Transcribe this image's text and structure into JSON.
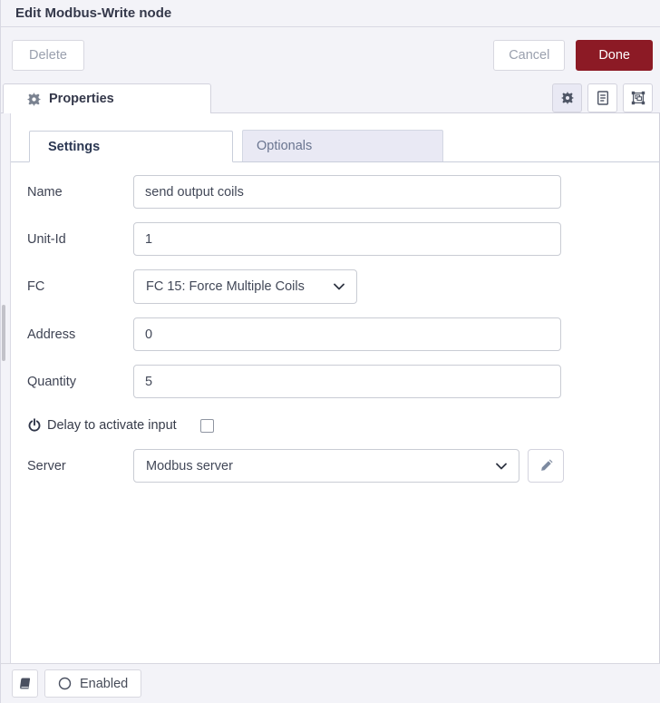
{
  "window": {
    "title": "Edit Modbus-Write node"
  },
  "toolbar": {
    "delete_label": "Delete",
    "cancel_label": "Cancel",
    "done_label": "Done"
  },
  "editor_tabs": {
    "properties_label": "Properties",
    "properties_icon": "gear-icon",
    "buttons": [
      {
        "name": "properties",
        "icon": "gear-icon",
        "active": true
      },
      {
        "name": "description",
        "icon": "document-icon",
        "active": false
      },
      {
        "name": "appearance",
        "icon": "appearance-icon",
        "active": false
      }
    ]
  },
  "form_tabs": {
    "settings_label": "Settings",
    "optionals_label": "Optionals",
    "active_tab": "Settings"
  },
  "fields": {
    "name": {
      "label": "Name",
      "value": "send output coils"
    },
    "unit_id": {
      "label": "Unit-Id",
      "value": "1"
    },
    "fc": {
      "label": "FC",
      "value": "FC 15: Force Multiple Coils",
      "icon": "chevron-down-icon"
    },
    "address": {
      "label": "Address",
      "value": "0"
    },
    "quantity": {
      "label": "Quantity",
      "value": "5"
    },
    "delay": {
      "label": "Delay to activate input",
      "icon": "power-icon",
      "checked": false
    },
    "server": {
      "label": "Server",
      "value": "Modbus server",
      "icon": "chevron-down-icon",
      "edit_icon": "pencil-icon"
    }
  },
  "footer": {
    "docs_icon": "book-icon",
    "enabled_icon": "circle-icon",
    "enabled_label": "Enabled"
  },
  "colors": {
    "done_red": "#8c1a25",
    "panel_bg": "#f3f3f8",
    "active_icon_bg": "#e9e9f4",
    "border": "#d3d3de",
    "inactive_tab_bg": "#e9e9f4"
  }
}
